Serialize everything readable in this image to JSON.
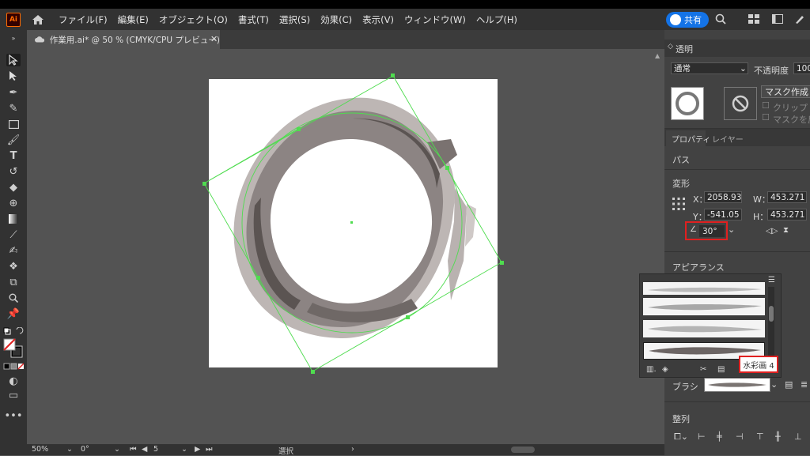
{
  "app": {
    "logo_text": "Ai",
    "menu": [
      "ファイル(F)",
      "編集(E)",
      "オブジェクト(O)",
      "書式(T)",
      "選択(S)",
      "効果(C)",
      "表示(V)",
      "ウィンドウ(W)",
      "ヘルプ(H)"
    ],
    "share_label": "共有"
  },
  "document": {
    "tab_title": "作業用.ai* @ 50 % (CMYK/CPU プレビュー)",
    "close_glyph": "✕"
  },
  "status": {
    "zoom": "50%",
    "rotation": "0°",
    "artboard": "5",
    "tool_status": "選択"
  },
  "transparency_panel": {
    "title": "透明",
    "blend_mode": "通常",
    "opacity_label": "不透明度",
    "opacity_value": "100",
    "mask_button": "マスク作成",
    "clip_label": "クリップ",
    "invert_label": "マスクを反"
  },
  "properties_panel": {
    "tabs": [
      "プロパティ",
      "レイヤー"
    ],
    "object_type": "パス",
    "transform_label": "変形",
    "x_label": "X：",
    "x_value": "2058.93",
    "y_label": "Y：",
    "y_value": "-541.05",
    "w_label": "W：",
    "w_value": "453.271",
    "h_label": "H：",
    "h_value": "453.271",
    "angle_value": "30°",
    "appearance_label": "アピアランス",
    "brush_label": "ブラシ",
    "align_label": "整列"
  },
  "brush_popup": {
    "tooltip": "水彩画 4"
  },
  "colors": {
    "accent_red": "#e02020",
    "selection_green": "#4fdc4f",
    "share_blue": "#1473e6"
  }
}
